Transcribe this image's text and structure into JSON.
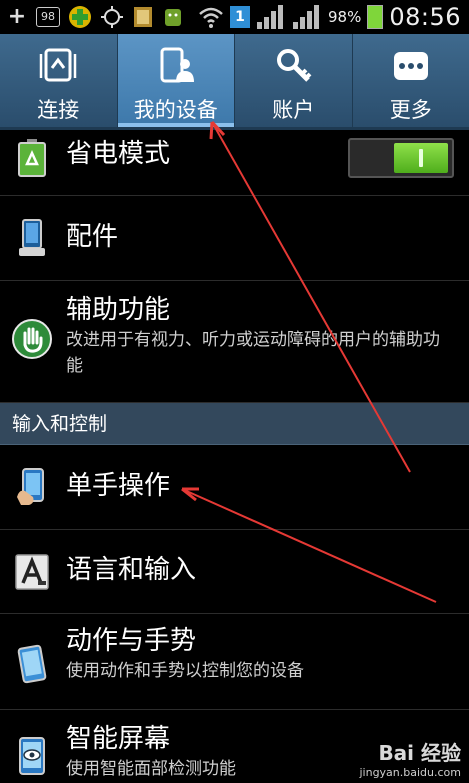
{
  "statusbar": {
    "box_label": "98",
    "sim_label": "1",
    "battery_percent": "98%",
    "clock": "08:56"
  },
  "tabs": [
    {
      "label": "连接",
      "icon": "connections-icon",
      "active": false
    },
    {
      "label": "我的设备",
      "icon": "my-device-icon",
      "active": true
    },
    {
      "label": "账户",
      "icon": "accounts-key-icon",
      "active": false
    },
    {
      "label": "更多",
      "icon": "more-dots-icon",
      "active": false
    }
  ],
  "items": {
    "power_saving": {
      "title": "省电模式",
      "icon": "recycle-battery-icon",
      "toggle_on": true
    },
    "accessory": {
      "title": "配件",
      "icon": "phone-dock-icon"
    },
    "accessibility": {
      "title": "辅助功能",
      "subtitle": "改进用于有视力、听力或运动障碍的用户的辅助功能",
      "icon": "hand-icon"
    },
    "one_handed": {
      "title": "单手操作",
      "icon": "hand-phone-icon"
    },
    "language": {
      "title": "语言和输入",
      "icon": "letter-a-icon"
    },
    "motion": {
      "title": "动作与手势",
      "subtitle": "使用动作和手势以控制您的设备",
      "icon": "tilted-phone-icon"
    },
    "smart_screen": {
      "title": "智能屏幕",
      "subtitle": "使用智能面部检测功能",
      "icon": "eye-phone-icon"
    }
  },
  "section": {
    "input_control": "输入和控制"
  },
  "colors": {
    "tab_bar": "#2a4d6c",
    "tab_active": "#4d86b8",
    "section_header": "#33485c",
    "toggle_on": "#6cc832",
    "annotation_arrow": "#e53935"
  },
  "watermark": {
    "logo": "Bai 经验",
    "url": "jingyan.baidu.com"
  }
}
